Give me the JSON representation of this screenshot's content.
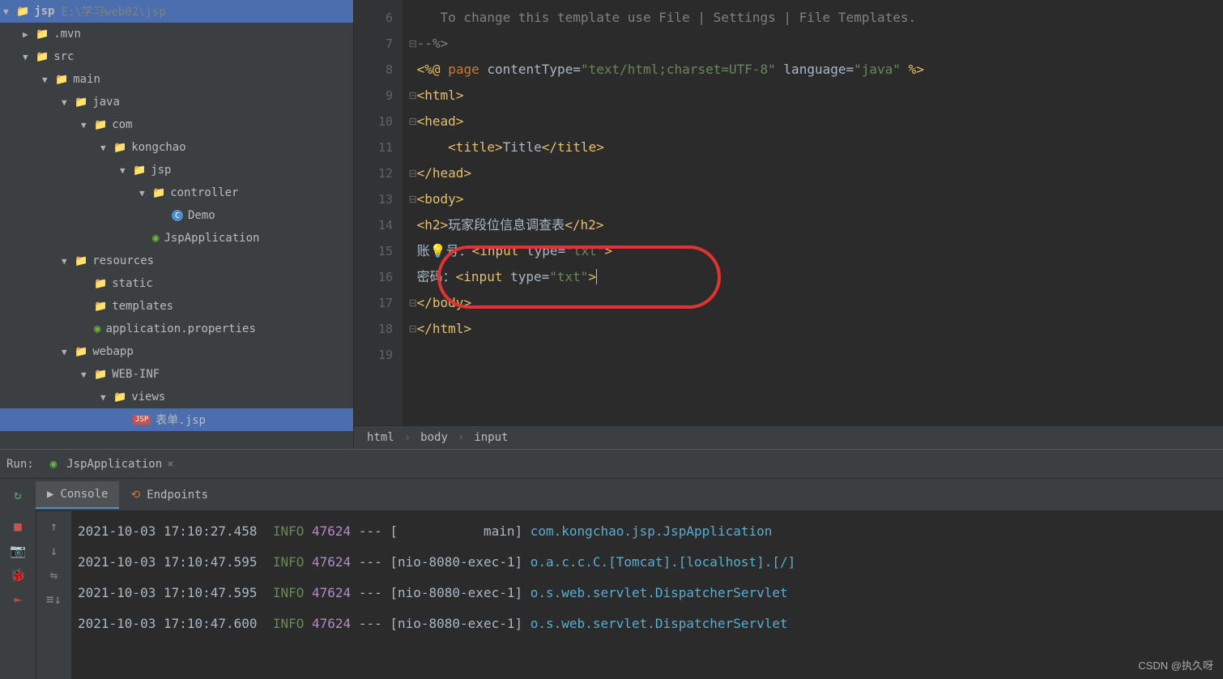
{
  "project": {
    "root": {
      "name": "jsp",
      "path": "E:\\学习web02\\jsp"
    },
    "tree": [
      {
        "label": ".mvn",
        "indent": 1,
        "arrow": "right",
        "icon": "folder"
      },
      {
        "label": "src",
        "indent": 1,
        "arrow": "down",
        "icon": "folder"
      },
      {
        "label": "main",
        "indent": 2,
        "arrow": "down",
        "icon": "folder"
      },
      {
        "label": "java",
        "indent": 3,
        "arrow": "down",
        "icon": "folder-blue"
      },
      {
        "label": "com",
        "indent": 4,
        "arrow": "down",
        "icon": "folder"
      },
      {
        "label": "kongchao",
        "indent": 5,
        "arrow": "down",
        "icon": "folder"
      },
      {
        "label": "jsp",
        "indent": 6,
        "arrow": "down",
        "icon": "folder"
      },
      {
        "label": "controller",
        "indent": 7,
        "arrow": "down",
        "icon": "folder"
      },
      {
        "label": "Demo",
        "indent": 8,
        "arrow": "none",
        "icon": "class"
      },
      {
        "label": "JspApplication",
        "indent": 7,
        "arrow": "none",
        "icon": "spring"
      },
      {
        "label": "resources",
        "indent": 3,
        "arrow": "down",
        "icon": "folder-yellow"
      },
      {
        "label": "static",
        "indent": 4,
        "arrow": "none",
        "icon": "folder"
      },
      {
        "label": "templates",
        "indent": 4,
        "arrow": "none",
        "icon": "folder"
      },
      {
        "label": "application.properties",
        "indent": 4,
        "arrow": "none",
        "icon": "spring"
      },
      {
        "label": "webapp",
        "indent": 3,
        "arrow": "down",
        "icon": "folder-blue"
      },
      {
        "label": "WEB-INF",
        "indent": 4,
        "arrow": "down",
        "icon": "folder"
      },
      {
        "label": "views",
        "indent": 5,
        "arrow": "down",
        "icon": "folder"
      },
      {
        "label": "表单.jsp",
        "indent": 6,
        "arrow": "none",
        "icon": "jsp",
        "selected": true
      }
    ]
  },
  "editor": {
    "lineStart": 6,
    "lines": {
      "6": "    To change this template use File | Settings | File Templates.",
      "7": "--%>",
      "8": "<%@ page contentType=\"text/html;charset=UTF-8\" language=\"java\" %>",
      "9": "<html>",
      "10": "<head>",
      "11": "    <title>Title</title>",
      "12": "</head>",
      "13": "<body>",
      "14": "<h2>玩家段位信息调查表</h2>",
      "15": "账号：<input type=\"txt\">",
      "16": "密码：<input type=\"txt\">",
      "17": "</body>",
      "18": "</html>",
      "19": ""
    },
    "breadcrumb": [
      "html",
      "body",
      "input"
    ]
  },
  "run": {
    "label": "Run:",
    "config": "JspApplication",
    "tabs": {
      "console": "Console",
      "endpoints": "Endpoints"
    },
    "logs": [
      {
        "ts": "2021-10-03 17:10:27.458",
        "level": "INFO",
        "pid": "47624",
        "sep": "---",
        "thread": "[           main]",
        "logger": "com.kongchao.jsp.JspApplication"
      },
      {
        "ts": "2021-10-03 17:10:47.595",
        "level": "INFO",
        "pid": "47624",
        "sep": "---",
        "thread": "[nio-8080-exec-1]",
        "logger": "o.a.c.c.C.[Tomcat].[localhost].[/]"
      },
      {
        "ts": "2021-10-03 17:10:47.595",
        "level": "INFO",
        "pid": "47624",
        "sep": "---",
        "thread": "[nio-8080-exec-1]",
        "logger": "o.s.web.servlet.DispatcherServlet"
      },
      {
        "ts": "2021-10-03 17:10:47.600",
        "level": "INFO",
        "pid": "47624",
        "sep": "---",
        "thread": "[nio-8080-exec-1]",
        "logger": "o.s.web.servlet.DispatcherServlet"
      }
    ]
  },
  "watermark": "CSDN @执久呀"
}
